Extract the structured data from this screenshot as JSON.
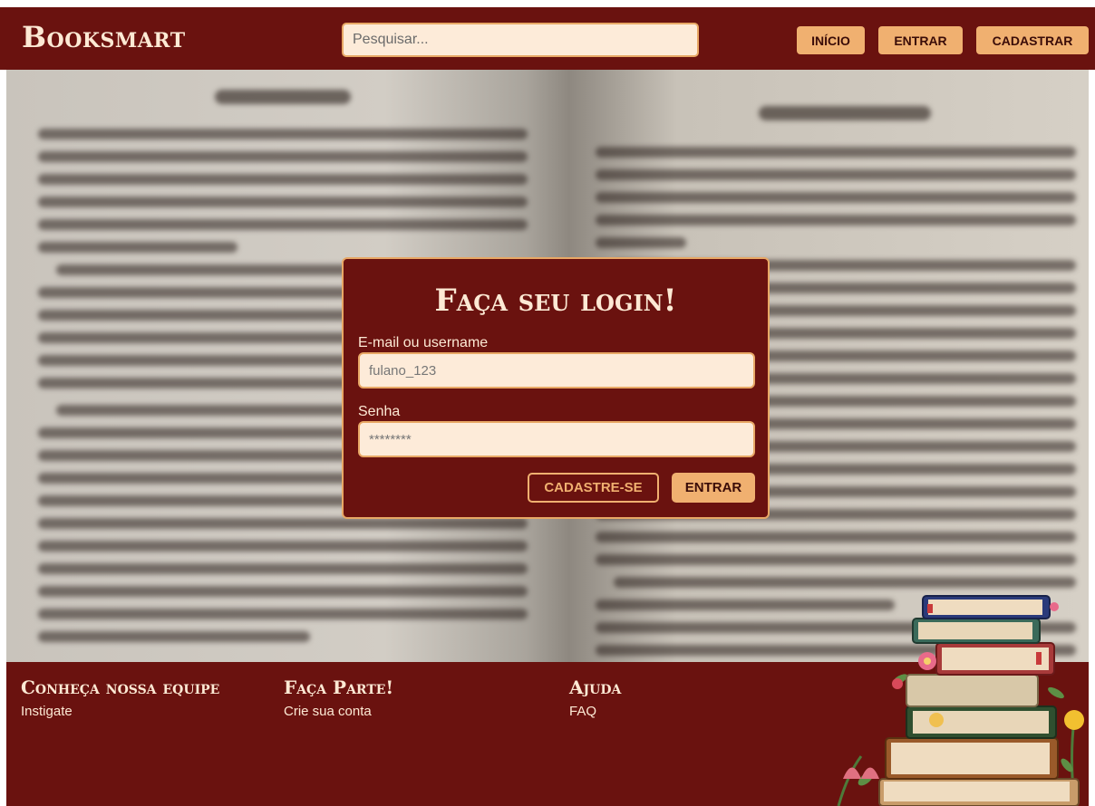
{
  "header": {
    "logo": "Booksmart",
    "search_placeholder": "Pesquisar...",
    "nav": {
      "inicio": "INÍCIO",
      "entrar": "ENTRAR",
      "cadastrar": "CADASTRAR"
    }
  },
  "login": {
    "title": "Faça seu login!",
    "email_label": "E-mail ou username",
    "email_value": "fulano_123",
    "password_label": "Senha",
    "password_value": "********",
    "signup_button": "CADASTRE-SE",
    "submit_button": "ENTRAR"
  },
  "footer": {
    "col1": {
      "title": "Conheça nossa equipe",
      "link": "Instigate"
    },
    "col2": {
      "title": "Faça Parte!",
      "link": "Crie sua conta"
    },
    "col3": {
      "title": "Ajuda",
      "link": "FAQ"
    }
  },
  "colors": {
    "brand_dark_red": "#6a120f",
    "accent_orange": "#f0b070",
    "cream": "#fde9d4"
  }
}
